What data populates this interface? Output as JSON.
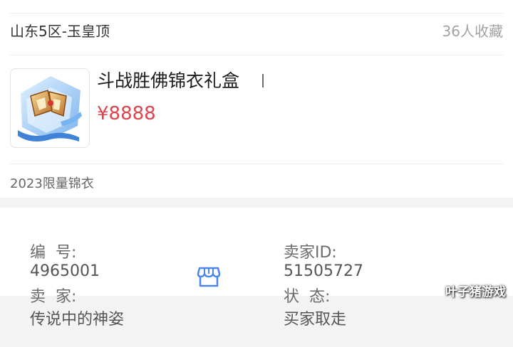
{
  "listing": {
    "server": "山东5区-玉皇顶",
    "favorites": "36人收藏",
    "item_title": "斗战胜佛锦衣礼盒",
    "price": "¥8888",
    "tag": "2023限量锦衣"
  },
  "details": {
    "number_label": "编  号:",
    "number_value": "4965001",
    "seller_id_label": "卖家ID:",
    "seller_id_value": "51505727",
    "seller_label": "卖  家:",
    "seller_value": "传说中的神姿",
    "status_label": "状  态:",
    "status_value": "买家取走"
  },
  "icons": {
    "item_image": "gift-box-thumbnail",
    "shop": "shop-icon"
  },
  "colors": {
    "price": "#e0424b",
    "shop_icon": "#4a86e8"
  },
  "watermark": "叶子猪游戏"
}
